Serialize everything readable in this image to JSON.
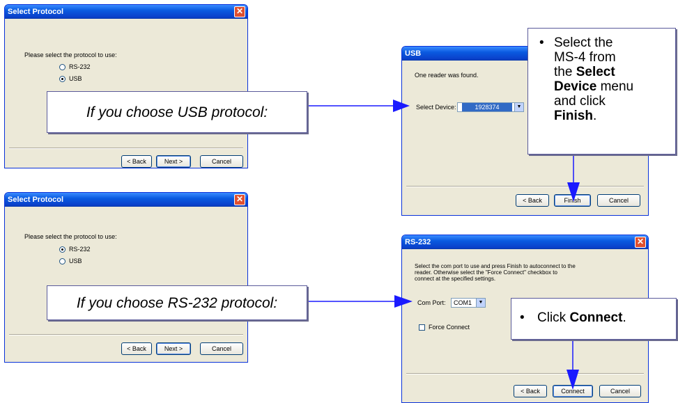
{
  "dialog_top": {
    "title": "Select Protocol",
    "prompt": "Please select the protocol to use:",
    "options": [
      "RS-232",
      "USB"
    ],
    "selected": "USB",
    "buttons": {
      "back": "< Back",
      "next": "Next >",
      "cancel": "Cancel"
    }
  },
  "dialog_bottom": {
    "title": "Select Protocol",
    "prompt": "Please select the protocol to use:",
    "options": [
      "RS-232",
      "USB"
    ],
    "selected": "RS-232",
    "buttons": {
      "back": "< Back",
      "next": "Next >",
      "cancel": "Cancel"
    }
  },
  "usb_dialog": {
    "title": "USB",
    "message": "One reader was found.",
    "device_label": "Select Device:",
    "device_value": "1928374",
    "buttons": {
      "back": "< Back",
      "finish": "Finish",
      "cancel": "Cancel"
    }
  },
  "rs232_dialog": {
    "title": "RS-232",
    "message_lines": [
      "Select the com port to use and press Finish to autoconnect to the",
      "reader. Otherwise select the \"Force Connect\" checkbox to",
      "connect at the specified settings."
    ],
    "port_label": "Com Port:",
    "port_value": "COM1",
    "force_label": "Force Connect",
    "buttons": {
      "back": "< Back",
      "connect": "Connect",
      "cancel": "Cancel"
    }
  },
  "callouts": {
    "usb_choice": "If you choose USB protocol:",
    "rs232_choice": "If you choose RS-232 protocol:",
    "usb_note": {
      "t1": "Select the",
      "t2": "MS-4 from",
      "t3": "the",
      "b1": "Select",
      "b2": "Device",
      "t4": "menu",
      "t5": "and click",
      "b3": "Finish",
      "t6": "."
    },
    "rs232_note": {
      "t1": "Click",
      "b1": "Connect",
      "t2": "."
    }
  },
  "colors": {
    "arrow": "#1a1aff",
    "titlebar": "#0a5ae0",
    "callout_border": "#5a5a9a"
  }
}
